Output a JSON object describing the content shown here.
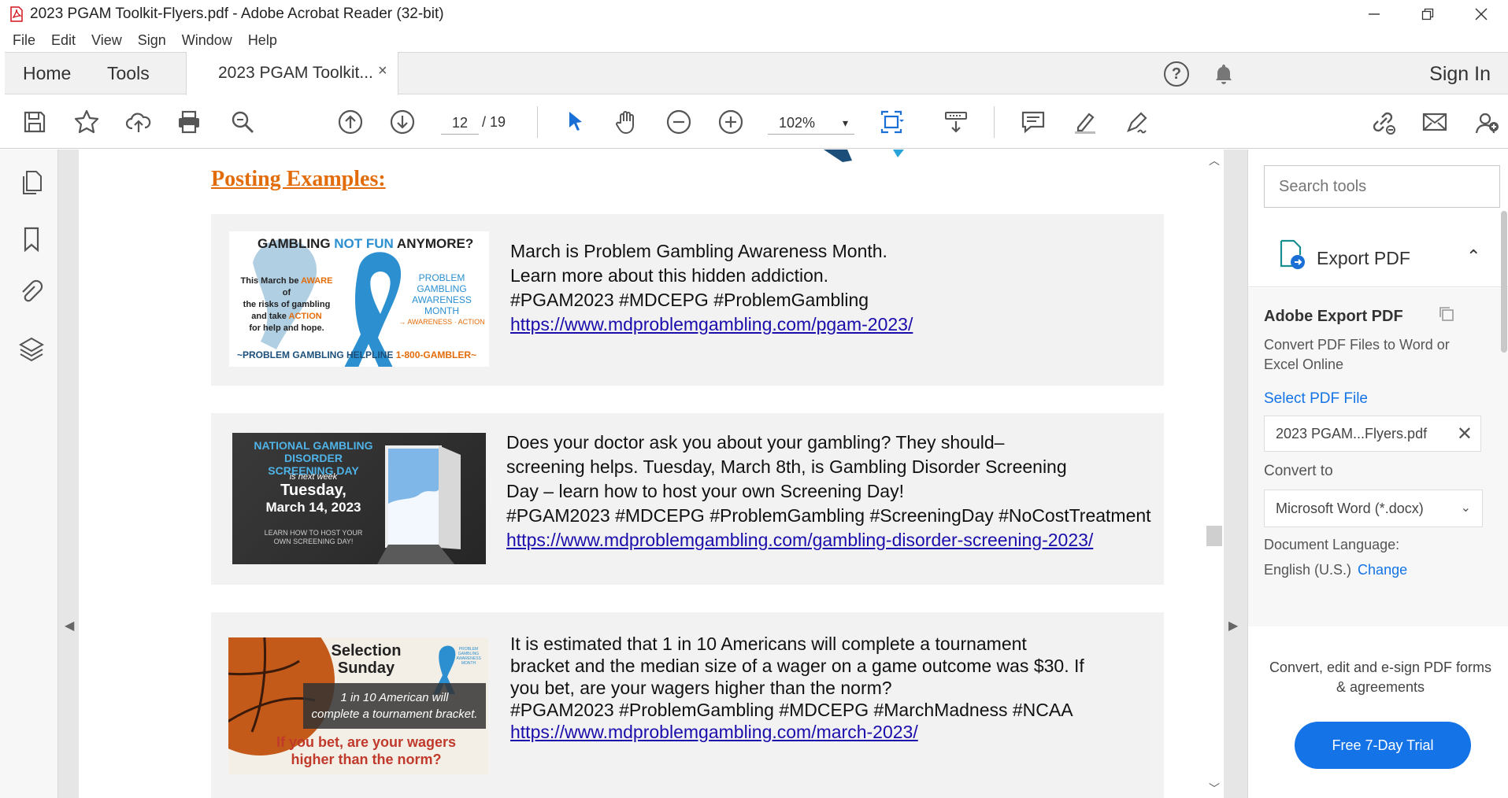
{
  "window": {
    "title": "2023 PGAM Toolkit-Flyers.pdf - Adobe Acrobat Reader (32-bit)",
    "minimize_icon": "minimize-icon",
    "restore_icon": "restore-icon",
    "close_icon": "close-icon"
  },
  "menu": [
    "File",
    "Edit",
    "View",
    "Sign",
    "Window",
    "Help"
  ],
  "tabs": {
    "home": "Home",
    "tools": "Tools",
    "document": "2023 PGAM Toolkit...",
    "close_symbol": "×",
    "sign_in": "Sign In",
    "help_symbol": "?"
  },
  "toolbar": {
    "page_current": "12",
    "page_total": "/ 19",
    "zoom": "102%",
    "zoom_caret": "▾"
  },
  "document": {
    "heading": "Posting Examples:",
    "posts": [
      {
        "image": {
          "headline_a": "GAMBLING ",
          "headline_b": "NOT FUN",
          "headline_c": " ANYMORE?",
          "body_1": "This March be ",
          "body_aware": "AWARE",
          "body_2": " of",
          "body_3": "the risks of gambling",
          "body_4": "and take ",
          "body_action": "ACTION",
          "body_5": "for help and hope.",
          "right_1": "PROBLEM GAMBLING",
          "right_2": "AWARENESS MONTH",
          "right_3": "→ AWARENESS · ACTION",
          "footer_a": "~PROBLEM GAMBLING HELPLINE ",
          "footer_b": "1-800-GAMBLER~"
        },
        "lines": [
          "March is Problem Gambling Awareness Month.",
          "Learn more about this hidden addiction.",
          "#PGAM2023 #MDCEPG #ProblemGambling"
        ],
        "link": "https://www.mdproblemgambling.com/pgam-2023/"
      },
      {
        "image": {
          "title_1": "NATIONAL GAMBLING DISORDER",
          "title_2": "SCREENING DAY",
          "next_week": "is next week",
          "day": "Tuesday,",
          "date": "March 14, 2023",
          "cta_1": "LEARN HOW TO HOST YOUR",
          "cta_2": "OWN SCREENING DAY!"
        },
        "lines": [
          "Does your doctor ask you about your gambling? They should–",
          "screening helps. Tuesday, March 8th, is Gambling Disorder Screening",
          "Day – learn how to host your own Screening Day!",
          "#PGAM2023 #MDCEPG #ProblemGambling #ScreeningDay #NoCostTreatment"
        ],
        "link": "https://www.mdproblemgambling.com/gambling-disorder-screening-2023/"
      },
      {
        "image": {
          "title_1": "Selection",
          "title_2": "Sunday",
          "badge_1": "PROBLEM GAMBLING",
          "badge_2": "AWARENESS MONTH",
          "stat_1": "1 in 10 American will",
          "stat_2": "complete a tournament bracket.",
          "q_1": "If you bet, are your wagers",
          "q_2": "higher than the norm?"
        },
        "lines": [
          "It is estimated that 1 in 10 Americans will complete a tournament",
          "bracket and the median size of a wager on a game outcome was $30. If",
          "you bet, are your wagers higher than the norm?",
          "#PGAM2023 #ProblemGambling #MDCEPG #MarchMadness #NCAA"
        ],
        "link": "https://www.mdproblemgambling.com/march-2023/"
      }
    ]
  },
  "right_panel": {
    "search_placeholder": "Search tools",
    "export_label": "Export PDF",
    "export_chevron": "⌃",
    "section_title": "Adobe Export PDF",
    "description": "Convert PDF Files to Word or Excel Online",
    "select_file": "Select PDF File",
    "file_name": "2023 PGAM...Flyers.pdf",
    "file_clear": "✕",
    "convert_to": "Convert to",
    "convert_value": "Microsoft Word (*.docx)",
    "convert_caret": "⌄",
    "doc_language_label": "Document Language:",
    "doc_language_value": "English (U.S.)",
    "change": "Change",
    "promo": "Convert, edit and e-sign PDF forms & agreements",
    "trial_button": "Free 7-Day Trial"
  },
  "colors": {
    "accent": "#1473e6",
    "heading_orange": "#e36c0a",
    "link": "#1a0dab",
    "card_bg": "#f2f2f2"
  }
}
